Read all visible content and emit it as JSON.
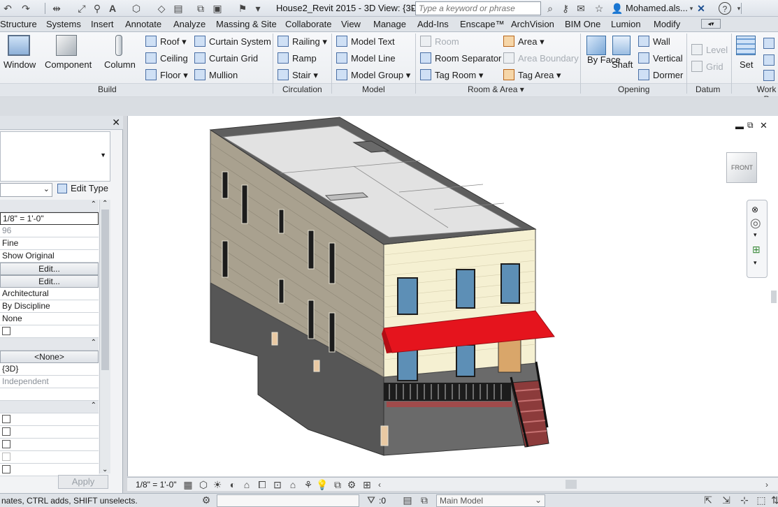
{
  "title_bar": {
    "document_title": "House2_Revit 2015 - 3D View: {3D}",
    "search_placeholder": "Type a keyword or phrase",
    "user": "Mohamed.als..."
  },
  "tabs": [
    "Structure",
    "Systems",
    "Insert",
    "Annotate",
    "Analyze",
    "Massing & Site",
    "Collaborate",
    "View",
    "Manage",
    "Add-Ins",
    "Enscape™",
    "ArchVision",
    "BIM One",
    "Lumion",
    "Modify"
  ],
  "ribbon": {
    "build": {
      "title": "Build",
      "large": [
        "Window",
        "Component",
        "Column"
      ],
      "col1": [
        "Roof",
        "Ceiling",
        "Floor"
      ],
      "col2": [
        "Curtain System",
        "Curtain Grid",
        "Mullion"
      ]
    },
    "circulation": {
      "title": "Circulation",
      "items": [
        "Railing",
        "Ramp",
        "Stair"
      ]
    },
    "model": {
      "title": "Model",
      "items": [
        "Model Text",
        "Model Line",
        "Model Group"
      ]
    },
    "room_area": {
      "title": "Room & Area",
      "col1": [
        "Room",
        "Room Separator",
        "Tag Room"
      ],
      "col2": [
        "Area",
        "Area Boundary",
        "Tag Area"
      ]
    },
    "opening": {
      "title": "Opening",
      "large": [
        "By Face",
        "Shaft"
      ],
      "items": [
        "Wall",
        "Vertical",
        "Dormer"
      ]
    },
    "datum": {
      "title": "Datum",
      "items": [
        "Level",
        "Grid"
      ]
    },
    "work_plane": {
      "title": "Work P",
      "large": [
        "Set"
      ]
    }
  },
  "properties": {
    "edit_type": "Edit Type",
    "rows": [
      "1/8\" = 1'-0\"",
      "96",
      "Fine",
      "Show Original",
      "Edit...",
      "Edit...",
      "Architectural",
      "By Discipline",
      "None"
    ],
    "none_button": "<None>",
    "view_name": "{3D}",
    "dependency": "Independent",
    "apply": "Apply"
  },
  "view": {
    "scale": "1/8\" = 1'-0\"",
    "viewcube_face": "FRONT"
  },
  "status_bar": {
    "message": "nates, CTRL adds, SHIFT unselects.",
    "zero": ":0",
    "workset": "Main Model"
  },
  "colors": {
    "awning": "#e5141d",
    "siding_front": "#f5f0d2",
    "siding_side": "#a9a18f",
    "foundation": "#555555",
    "roof": "#e2e2e2"
  }
}
